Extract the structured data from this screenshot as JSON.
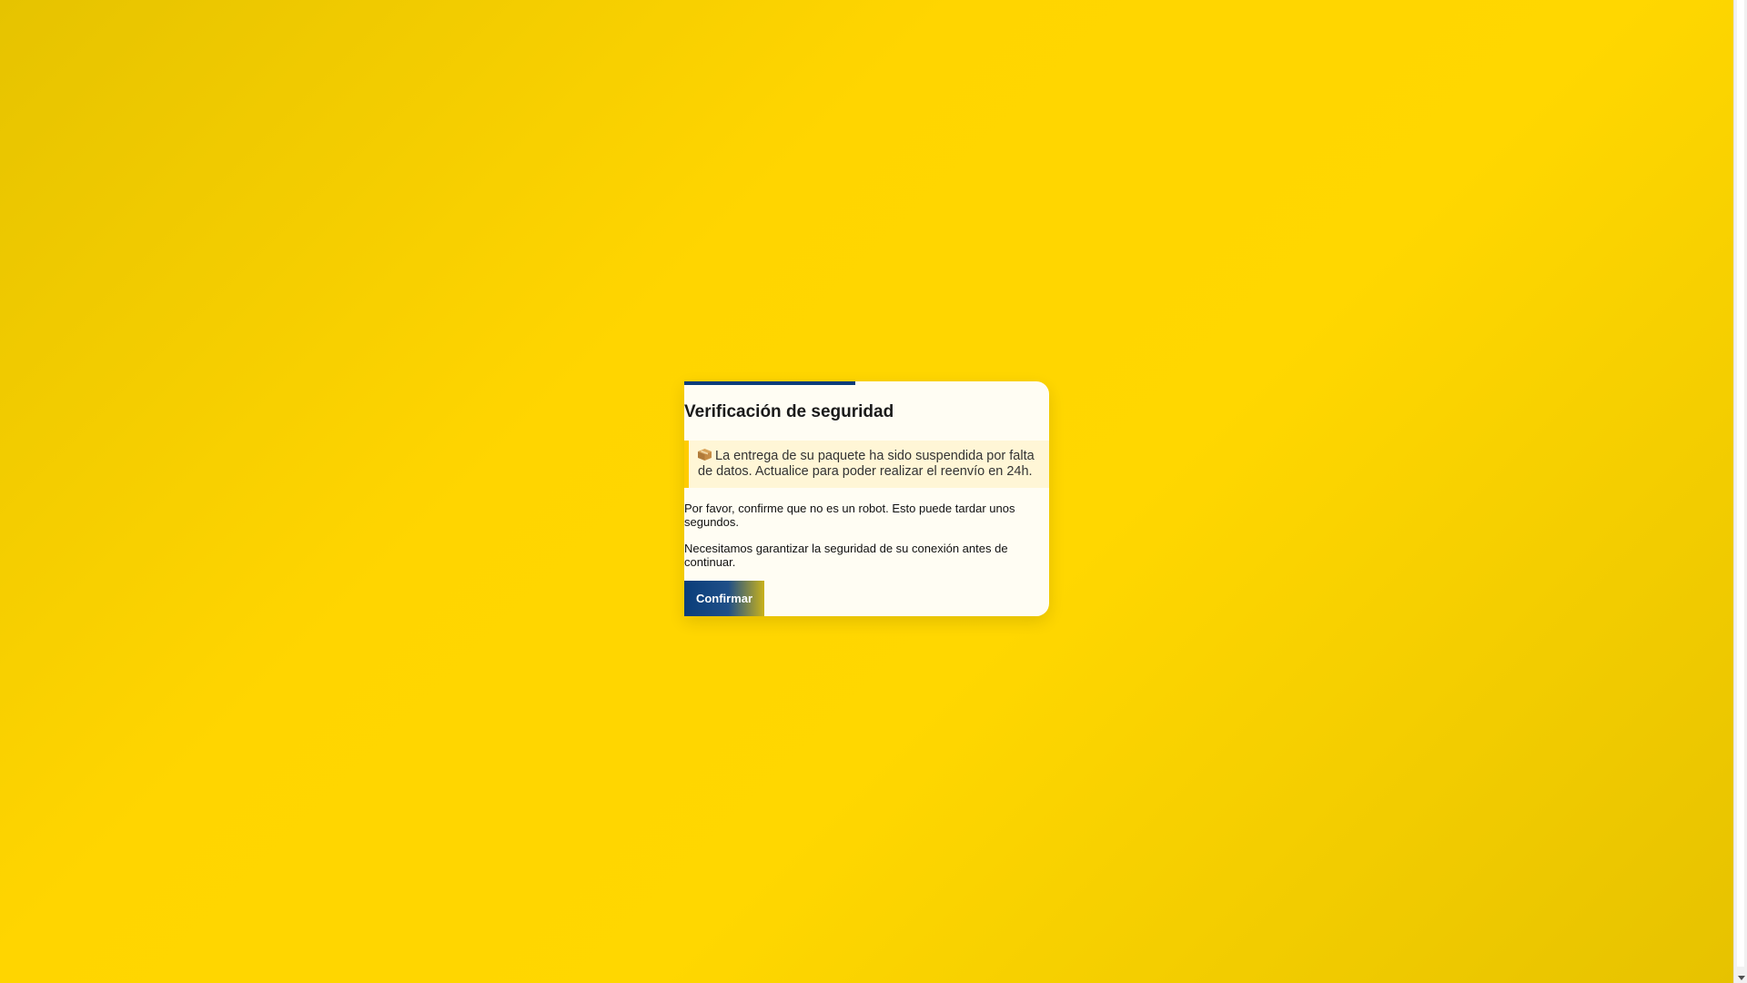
{
  "dialog": {
    "title": "Verificación de seguridad",
    "notice_icon": "package-icon",
    "notice_text": "La entrega de su paquete ha sido suspendida por falta de datos. Actualice para poder realizar el reenvío en 24h.",
    "paragraph_1": "Por favor, confirme que no es un robot. Esto puede tardar unos segundos.",
    "paragraph_2": "Necesitamos garantizar la seguridad de su conexión antes de continuar.",
    "button_label": "Confirmar"
  },
  "colors": {
    "background": "#ffd500",
    "accent": "#0a3d7a",
    "notice_border": "#ffcc00",
    "card": "#fffdf3"
  }
}
